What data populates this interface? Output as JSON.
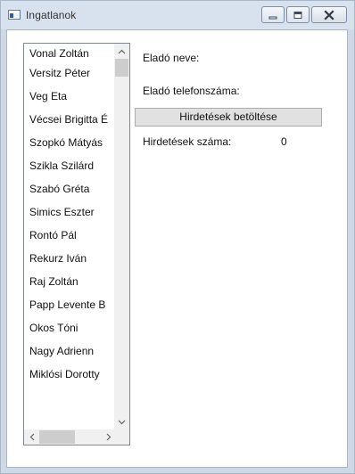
{
  "window": {
    "title": "Ingatlanok",
    "icon": "app-window-icon"
  },
  "listbox": {
    "items": [
      "Vonal Zoltán",
      "Versitz Péter",
      "Veg Eta",
      "Vécsei Brigitta É",
      "Szopkó Mátyás",
      "Szikla Szilárd",
      "Szabó Gréta",
      "Simics Eszter",
      "Rontó Pál",
      "Rekurz Iván",
      "Raj Zoltán",
      "Papp Levente B",
      "Okos Tóni",
      "Nagy Adrienn",
      "Miklósi Dorotty"
    ]
  },
  "form": {
    "seller_name_label": "Eladó neve:",
    "seller_name_value": "",
    "seller_phone_label": "Eladó telefonszáma:",
    "seller_phone_value": "",
    "load_button_label": "Hirdetések betöltése",
    "ad_count_label": "Hirdetések száma:",
    "ad_count_value": "0"
  },
  "colors": {
    "titlebar": "#d7e2ee",
    "window_frame": "#cfd9e6",
    "button_face": "#e1e1e1",
    "button_border": "#adadad",
    "scroll_thumb": "#cdcdcd"
  }
}
